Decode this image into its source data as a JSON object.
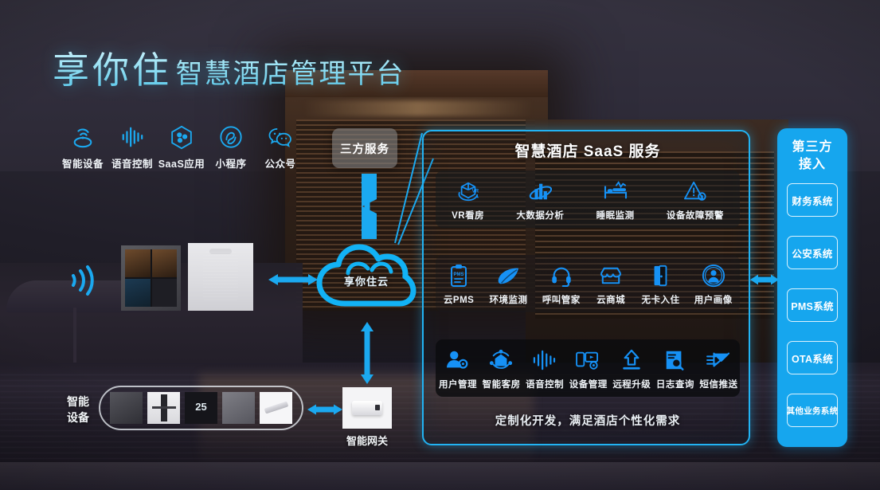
{
  "header": {
    "brand": "享你住",
    "subtitle": "智慧酒店管理平台"
  },
  "colors": {
    "accent_cyan": "#22b3f3",
    "accent_blue": "#16a6ee",
    "panel_border": "#22b3f3",
    "title_gradient_top": "#dff6ff",
    "title_gradient_bottom": "#4fc3e8",
    "third_party_box": "#808080"
  },
  "channels": {
    "items": [
      {
        "label": "智能设备",
        "icon": "smart-device-icon"
      },
      {
        "label": "语音控制",
        "icon": "voice-wave-icon"
      },
      {
        "label": "SaaS应用",
        "icon": "hexagon-molecule-icon"
      },
      {
        "label": "小程序",
        "icon": "mini-program-icon"
      },
      {
        "label": "公众号",
        "icon": "wechat-icon"
      }
    ]
  },
  "third_party_service": {
    "label": "三方服务"
  },
  "cloud": {
    "label": "享你住云",
    "icon": "cloud-icon"
  },
  "saas": {
    "title": "智慧酒店 SaaS 服务",
    "footer": "定制化开发，满足酒店个性化需求",
    "rows": [
      {
        "name": "row-value-services",
        "items": [
          {
            "label": "VR看房",
            "icon": "vr-cube-icon"
          },
          {
            "label": "大数据分析",
            "icon": "bar-chart-orbit-icon"
          },
          {
            "label": "睡眠监测",
            "icon": "bed-monitor-icon"
          },
          {
            "label": "设备故障预警",
            "icon": "warning-gear-icon"
          }
        ]
      },
      {
        "name": "row-business-services",
        "items": [
          {
            "label": "云PMS",
            "icon": "clipboard-pms-icon"
          },
          {
            "label": "环境监测",
            "icon": "leaf-icon"
          },
          {
            "label": "呼叫管家",
            "icon": "headset-icon"
          },
          {
            "label": "云商城",
            "icon": "shop-icon"
          },
          {
            "label": "无卡入住",
            "icon": "door-icon"
          },
          {
            "label": "用户画像",
            "icon": "user-badge-icon"
          }
        ]
      },
      {
        "name": "row-management-services",
        "items": [
          {
            "label": "用户管理",
            "icon": "user-gear-icon"
          },
          {
            "label": "智能客房",
            "icon": "smart-room-icon"
          },
          {
            "label": "语音控制",
            "icon": "voice-wave-icon"
          },
          {
            "label": "设备管理",
            "icon": "device-gear-icon"
          },
          {
            "label": "远程升级",
            "icon": "upload-arrow-icon"
          },
          {
            "label": "日志查询",
            "icon": "log-search-icon"
          },
          {
            "label": "短信推送",
            "icon": "envelope-send-icon"
          }
        ]
      }
    ]
  },
  "third_party_access": {
    "title_line1": "第三方",
    "title_line2": "接入",
    "items": [
      {
        "label": "财务系统"
      },
      {
        "label": "公安系统"
      },
      {
        "label": "PMS系统"
      },
      {
        "label": "OTA系统"
      },
      {
        "label": "其他业务系统"
      }
    ]
  },
  "devices": {
    "rail_label_line1": "智能",
    "rail_label_line2": "设备",
    "thumbnails": [
      {
        "name": "smart-switch-panel"
      },
      {
        "name": "smart-door-lock"
      },
      {
        "name": "smart-thermostat",
        "value": "25"
      },
      {
        "name": "smart-socket"
      },
      {
        "name": "smart-curtain-motor"
      }
    ]
  },
  "gateway": {
    "label": "智能网关"
  },
  "connectors": [
    {
      "name": "arrow-service-to-cloud",
      "direction": "vertical"
    },
    {
      "name": "arrow-device-to-cloud",
      "direction": "horizontal"
    },
    {
      "name": "arrow-cloud-to-gateway",
      "direction": "vertical"
    },
    {
      "name": "arrow-rail-to-gateway",
      "direction": "horizontal"
    },
    {
      "name": "arrow-saas-to-third-party",
      "direction": "horizontal"
    },
    {
      "name": "line-cloud-to-saas",
      "direction": "diagonal"
    }
  ]
}
